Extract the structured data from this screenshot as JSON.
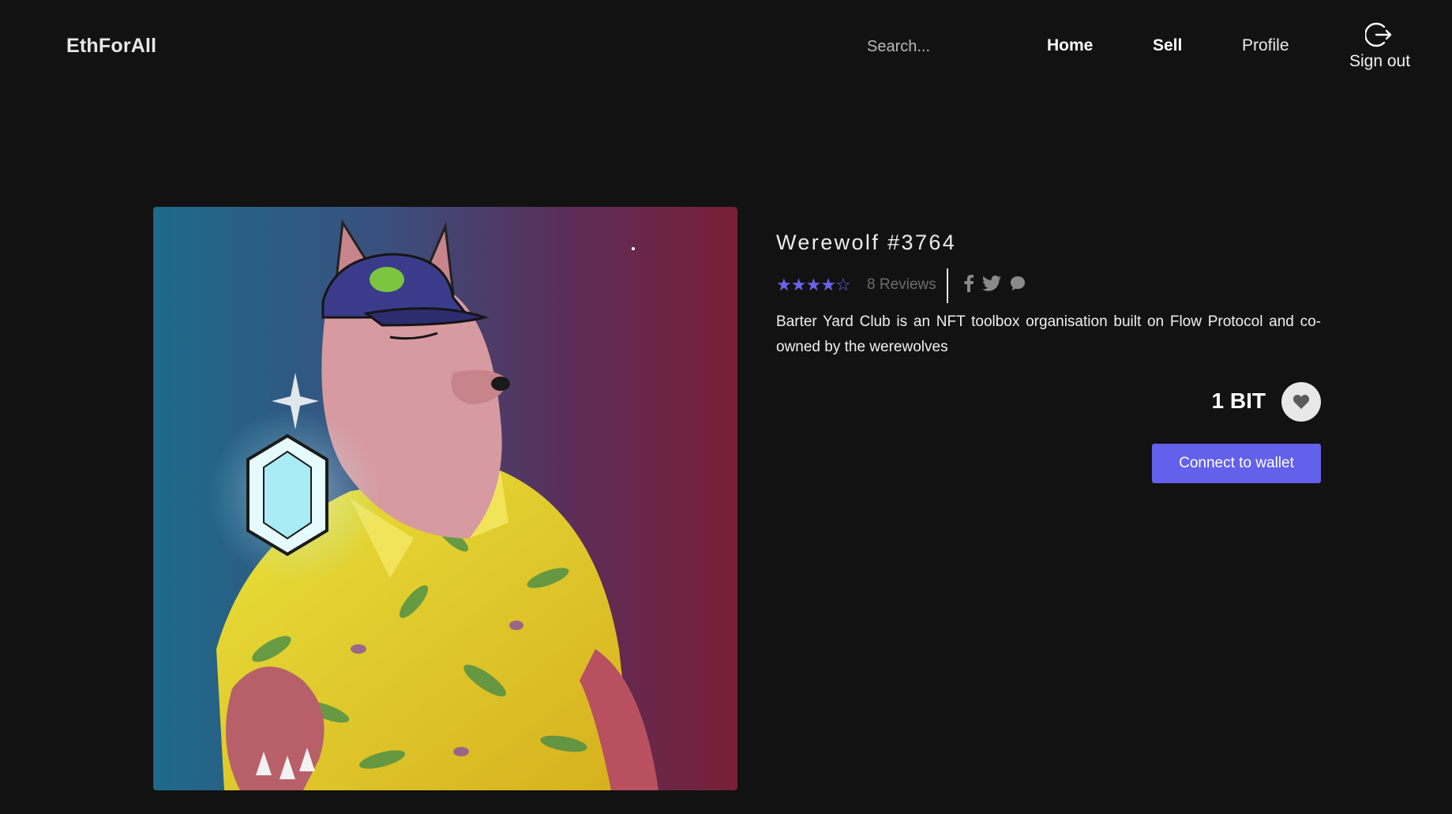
{
  "header": {
    "brand": "EthForAll",
    "search_placeholder": "Search...",
    "nav": {
      "home": "Home",
      "sell": "Sell",
      "profile": "Profile",
      "signout": "Sign out"
    },
    "signout_icon": "logout-icon"
  },
  "product": {
    "image_icon": "werewolf-nft-artwork",
    "title": "Werewolf #3764",
    "rating": 4,
    "rating_max": 5,
    "reviews": "8 Reviews",
    "social_icons": [
      "facebook-icon",
      "twitter-icon",
      "chat-icon"
    ],
    "description": "Barter Yard Club is an NFT toolbox organisation built on Flow Protocol and co-owned by the werewolves",
    "price": "1 BIT",
    "favorite_icon": "heart-icon",
    "connect_button": "Connect to wallet"
  },
  "colors": {
    "background": "#121212",
    "accent": "#6360eb",
    "star": "#6b63ea"
  }
}
